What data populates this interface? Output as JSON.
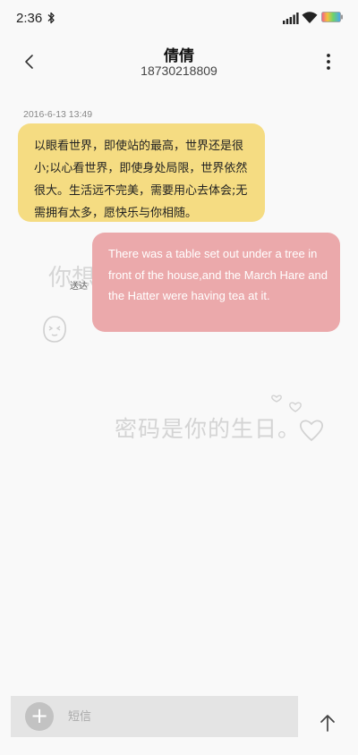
{
  "status_bar": {
    "time": "2:36",
    "icons": [
      "bluetooth-icon",
      "signal-icon",
      "wifi-icon",
      "battery-icon"
    ]
  },
  "header": {
    "title": "倩倩",
    "phone_number": "18730218809",
    "icons": [
      "back-arrow-icon",
      "more-vertical-icon"
    ]
  },
  "messages": [
    {
      "direction": "incoming",
      "timestamp": "2016-6-13 13:49",
      "text": "以眼看世界，即使站的最高，世界还是很小;以心看世界，即使身处局限，世界依然很大。生活远不完美，需要用心去体会;无需拥有太多，愿快乐与你相随。",
      "color": "#f5dc82"
    },
    {
      "direction": "outgoing",
      "text": "There was a table set out under a tree in front of the house,and the March Hare and the Hatter were having tea at it.",
      "color": "#eba9ab",
      "status": "送达"
    }
  ],
  "watermark": {
    "text_1": "你想",
    "text_2": "密码是你的生日。",
    "icons": [
      "face-doodle-icon",
      "hearts-doodle-icon"
    ]
  },
  "composer": {
    "placeholder": "短信",
    "value": "",
    "icons": [
      "add-icon",
      "send-arrow-icon"
    ]
  },
  "colors": {
    "background": "#f9f9f9",
    "composer_bg": "#e4e4e4",
    "incoming_bubble": "#f5dc82",
    "outgoing_bubble": "#eba9ab"
  }
}
